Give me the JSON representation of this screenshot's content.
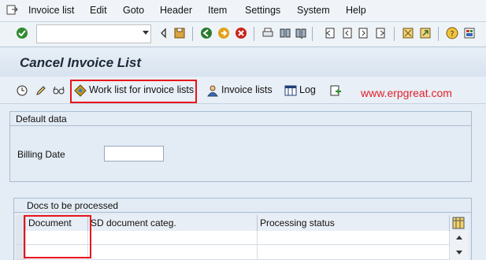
{
  "menubar": {
    "items": [
      "Invoice list",
      "Edit",
      "Goto",
      "Header",
      "Item",
      "Settings",
      "System",
      "Help"
    ]
  },
  "toolbar": {
    "command_field_value": "",
    "icons": [
      "enter-icon",
      "back-icon",
      "exit-icon",
      "cancel-icon",
      "print-icon",
      "find-icon",
      "find-next-icon",
      "first-page-icon",
      "prev-page-icon",
      "next-page-icon",
      "last-page-icon",
      "create-session-icon",
      "shortcut-icon",
      "help-icon",
      "customize-layout-icon"
    ]
  },
  "title": "Cancel Invoice List",
  "app_toolbar": {
    "worklist_label": "Work list for invoice lists",
    "invoice_lists_label": "Invoice lists",
    "log_label": "Log"
  },
  "watermark": "www.erpgreat.com",
  "default_data": {
    "title": "Default data",
    "billing_date_label": "Billing Date",
    "billing_date_value": ""
  },
  "docs": {
    "title": "Docs to be processed",
    "columns": [
      "Document",
      "SD document categ.",
      "Processing status"
    ],
    "rows": [
      [
        "",
        "",
        ""
      ],
      [
        "",
        "",
        ""
      ]
    ]
  },
  "colors": {
    "highlight": "#e8141b",
    "watermark": "#e31f2a",
    "background": "#e4ecf5"
  }
}
